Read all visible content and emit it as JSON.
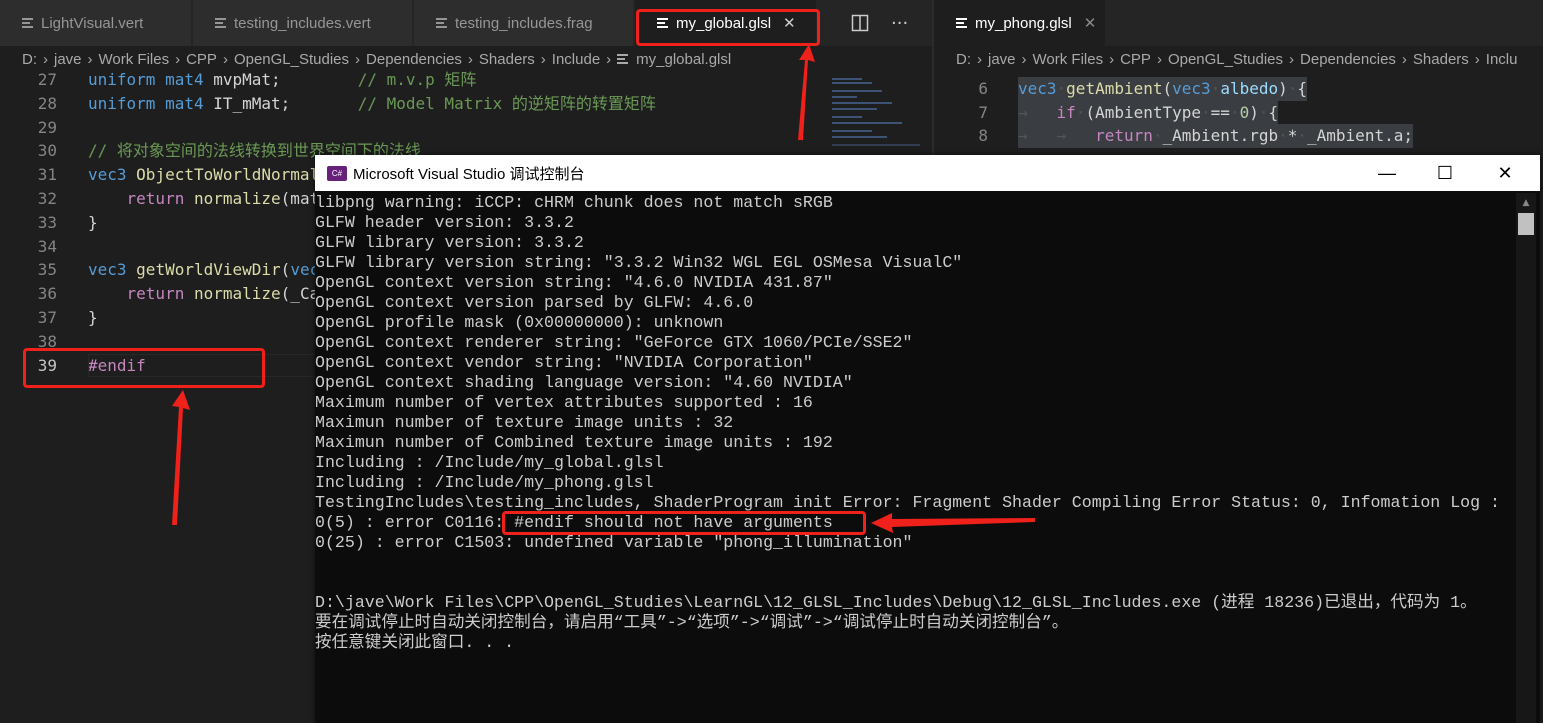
{
  "left_editor": {
    "tabs": [
      {
        "label": "LightVisual.vert",
        "active": false
      },
      {
        "label": "testing_includes.vert",
        "active": false
      },
      {
        "label": "testing_includes.frag",
        "active": false
      },
      {
        "label": "my_global.glsl",
        "active": true
      }
    ],
    "close_glyph": "✕",
    "split_icon": "split-editor-icon",
    "more_icon": "more-actions-icon",
    "breadcrumb": [
      "D:",
      "jave",
      "Work Files",
      "CPP",
      "OpenGL_Studies",
      "Dependencies",
      "Shaders",
      "Include",
      "my_global.glsl"
    ],
    "lines": [
      {
        "n": "27",
        "tokens": [
          [
            "uniform ",
            "kw"
          ],
          [
            "mat4 ",
            "kw"
          ],
          [
            "mvpMat;        ",
            "pl"
          ],
          [
            "// m.v.p 矩阵",
            "cm"
          ]
        ]
      },
      {
        "n": "28",
        "tokens": [
          [
            "uniform ",
            "kw"
          ],
          [
            "mat4 ",
            "kw"
          ],
          [
            "IT_mMat;       ",
            "pl"
          ],
          [
            "// Model Matrix 的逆矩阵的转置矩阵",
            "cm"
          ]
        ]
      },
      {
        "n": "29",
        "tokens": []
      },
      {
        "n": "30",
        "tokens": [
          [
            "// 将对象空间的法线转换到世界空间下的法线",
            "cm"
          ]
        ]
      },
      {
        "n": "31",
        "tokens": [
          [
            "vec3 ",
            "kw"
          ],
          [
            "ObjectToWorldNormal",
            "fn"
          ]
        ]
      },
      {
        "n": "32",
        "tokens": [
          [
            "    ",
            "pl"
          ],
          [
            "return ",
            "ctl"
          ],
          [
            "normalize",
            "fn"
          ],
          [
            "(mat",
            "pl"
          ]
        ]
      },
      {
        "n": "33",
        "tokens": [
          [
            "}",
            "pl"
          ]
        ]
      },
      {
        "n": "34",
        "tokens": []
      },
      {
        "n": "35",
        "tokens": [
          [
            "vec3 ",
            "kw"
          ],
          [
            "getWorldViewDir",
            "fn"
          ],
          [
            "(",
            "pl"
          ],
          [
            "vec",
            "kw"
          ]
        ]
      },
      {
        "n": "36",
        "tokens": [
          [
            "    ",
            "pl"
          ],
          [
            "return ",
            "ctl"
          ],
          [
            "normalize",
            "fn"
          ],
          [
            "(_Ca",
            "pl"
          ]
        ]
      },
      {
        "n": "37",
        "tokens": [
          [
            "}",
            "pl"
          ]
        ]
      },
      {
        "n": "38",
        "tokens": []
      },
      {
        "n": "39",
        "tokens": [
          [
            "#endif",
            "ctl"
          ]
        ],
        "current": true
      }
    ]
  },
  "right_editor": {
    "tabs": [
      {
        "label": "my_phong.glsl",
        "active": true
      }
    ],
    "close_glyph": "✕",
    "breadcrumb": [
      "D:",
      "jave",
      "Work Files",
      "CPP",
      "OpenGL_Studies",
      "Dependencies",
      "Shaders",
      "Inclu"
    ],
    "lines": [
      {
        "n": "6",
        "tokens": [
          [
            "vec3",
            "kw"
          ],
          [
            "·",
            "ws"
          ],
          [
            "getAmbient",
            "fn"
          ],
          [
            "(",
            "pl"
          ],
          [
            "vec3",
            "kw"
          ],
          [
            "·",
            "ws"
          ],
          [
            "albedo",
            "var"
          ],
          [
            ")",
            "pl"
          ],
          [
            "·",
            "ws"
          ],
          [
            "{",
            "pl"
          ]
        ]
      },
      {
        "n": "7",
        "tokens": [
          [
            "→   ",
            "ws"
          ],
          [
            "if",
            "ctl"
          ],
          [
            "·",
            "ws"
          ],
          [
            "(AmbientType",
            "pl"
          ],
          [
            "·",
            "ws"
          ],
          [
            "==",
            "pl"
          ],
          [
            "·",
            "ws"
          ],
          [
            "0",
            "num"
          ],
          [
            ")",
            "pl"
          ],
          [
            "·",
            "ws"
          ],
          [
            "{",
            "pl"
          ]
        ]
      },
      {
        "n": "8",
        "tokens": [
          [
            "→   ",
            "ws"
          ],
          [
            "→   ",
            "ws"
          ],
          [
            "return",
            "ctl"
          ],
          [
            "·",
            "ws"
          ],
          [
            "_Ambient.rgb",
            "pl"
          ],
          [
            "·",
            "ws"
          ],
          [
            "*",
            "pl"
          ],
          [
            "·",
            "ws"
          ],
          [
            "_Ambient.a;",
            "pl"
          ]
        ]
      }
    ]
  },
  "console": {
    "title": "Microsoft Visual Studio 调试控制台",
    "app_icon": "C#",
    "minimize": "—",
    "maximize": "☐",
    "close": "✕",
    "lines": [
      "libpng warning: iCCP: cHRM chunk does not match sRGB",
      "GLFW header version: 3.3.2",
      "GLFW library version: 3.3.2",
      "GLFW library version string: ″3.3.2 Win32 WGL EGL OSMesa VisualC″",
      "OpenGL context version string: ″4.6.0 NVIDIA 431.87″",
      "OpenGL context version parsed by GLFW: 4.6.0",
      "OpenGL profile mask (0x00000000): unknown",
      "OpenGL context renderer string: ″GeForce GTX 1060/PCIe/SSE2″",
      "OpenGL context vendor string: ″NVIDIA Corporation″",
      "OpenGL context shading language version: ″4.60 NVIDIA″",
      "Maximum number of vertex attributes supported : 16",
      "Maximun number of texture image units : 32",
      "Maximun number of Combined texture image units : 192",
      "Including : /Include/my_global.glsl",
      "Including : /Include/my_phong.glsl",
      "TestingIncludes\\testing_includes, ShaderProgram init Error: Fragment Shader Compiling Error Status: 0, Infomation Log :",
      "0(5) : error C0116: #endif should not have arguments",
      "0(25) : error C1503: undefined variable ″phong_illumination″",
      "",
      "",
      "D:\\jave\\Work Files\\CPP\\OpenGL_Studies\\LearnGL\\12_GLSL_Includes\\Debug\\12_GLSL_Includes.exe (进程 18236)已退出，代码为 1。",
      "要在调试停止时自动关闭控制台，请启用“工具”->“选项”->“调试”->“调试停止时自动关闭控制台”。",
      "按任意键关闭此窗口. . ."
    ]
  },
  "annotation_color": "#f0201a"
}
